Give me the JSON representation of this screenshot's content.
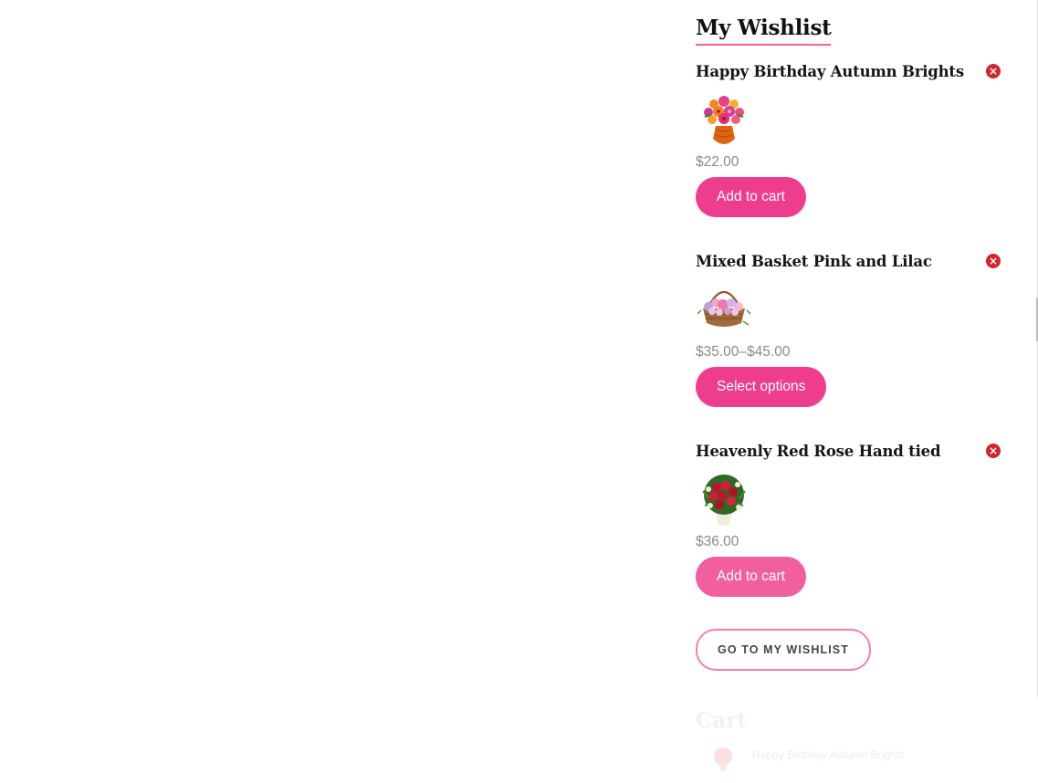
{
  "wishlist": {
    "title": "My Wishlist",
    "items": [
      {
        "name": "Happy Birthday Autumn Brights",
        "price": "$22.00",
        "button_label": "Add to cart",
        "remove_icon": "remove-circle-icon",
        "image": "autumn-bouquet-thumbnail"
      },
      {
        "name": "Mixed Basket Pink and Lilac",
        "price": "$35.00–$45.00",
        "button_label": "Select options",
        "remove_icon": "remove-circle-icon",
        "image": "pink-lilac-basket-thumbnail"
      },
      {
        "name": "Heavenly Red Rose Hand tied",
        "price": "$36.00",
        "button_label": "Add to cart",
        "remove_icon": "remove-circle-icon",
        "image": "red-rose-bouquet-thumbnail"
      }
    ],
    "goto_label": "GO TO MY WISHLIST"
  },
  "cart": {
    "title": "Cart",
    "items": [
      {
        "name": "Happy Birthday Autumn Brights"
      }
    ]
  },
  "colors": {
    "accent": "#ef3d8d",
    "remove": "#d2262e",
    "price": "#8a8a8a",
    "goto_border": "#f37fb0"
  }
}
